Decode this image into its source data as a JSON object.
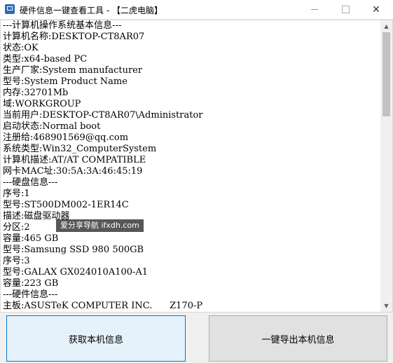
{
  "window": {
    "title": "硬件信息一键查看工具 - 【二虎电脑】",
    "close_symbol": "✕"
  },
  "info_lines": [
    "---计算机操作系统基本信息---",
    "计算机名称:DESKTOP-CT8AR07",
    "状态:OK",
    "类型:x64-based PC",
    "生产厂家:System manufacturer",
    "型号:System Product Name",
    "内存:32701Mb",
    "域:WORKGROUP",
    "当前用户:DESKTOP-CT8AR07\\Administrator",
    "启动状态:Normal boot",
    "注册给:468901569@qq.com",
    "系统类型:Win32_ComputerSystem",
    "计算机描述:AT/AT COMPATIBLE",
    "网卡MAC址:30:5A:3A:46:45:19",
    "---硬盘信息---",
    "序号:1",
    "型号:ST500DM002-1ER14C",
    "描述:磁盘驱动器",
    "分区:2",
    "容量:465 GB",
    "型号:Samsung SSD 980 500GB",
    "序号:3",
    "型号:GALAX GX024010A100-A1",
    "容量:223 GB",
    "---硬件信息---",
    "主板:ASUSTeK COMPUTER INC.      Z170-P"
  ],
  "watermark": "爱分享导航 ifxdh.com",
  "buttons": {
    "get_info": "获取本机信息",
    "export_info": "一键导出本机信息"
  }
}
